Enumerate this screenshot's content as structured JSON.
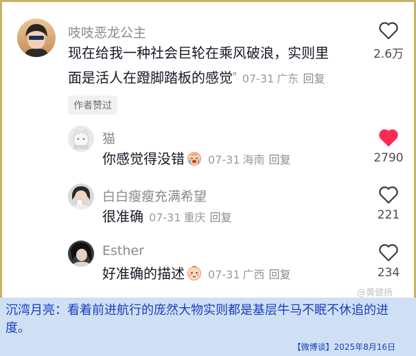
{
  "comments": [
    {
      "username": "吱吱恶龙公主",
      "text_line1": "现在给我一种社会巨轮在乘风破浪，实则里",
      "text_line2": "面是活人在蹬脚踏板的感觉",
      "search_mark": "ᵒ",
      "date": "07-31",
      "location": "广东",
      "reply": "回复",
      "likes": "2.6万",
      "badge": "作者赞过",
      "liked": false
    },
    {
      "username": "猫",
      "text": "你感觉得没错",
      "date": "07-31",
      "location": "海南",
      "reply": "回复",
      "likes": "2790",
      "liked": true
    },
    {
      "username": "白白瘦瘦充满希望",
      "text": "很准确",
      "date": "07-31",
      "location": "重庆",
      "reply": "回复",
      "likes": "221",
      "liked": false
    },
    {
      "username": "Esther",
      "text": "好准确的描述",
      "date": "07-31",
      "location": "广西",
      "reply": "回复",
      "likes": "234",
      "liked": false
    }
  ],
  "watermark": "@黄健扬",
  "caption": {
    "text": "沉湾月亮：看着前进航行的庞然大物实则都是基层牛马不眠不休追的进度。",
    "footer": "【微博谈】2025年8月16日"
  },
  "colors": {
    "liked_heart": "#fe2c55",
    "caption_text": "#1a3fbf",
    "caption_bg": "#cfe0f4",
    "border": "#c8b260"
  }
}
